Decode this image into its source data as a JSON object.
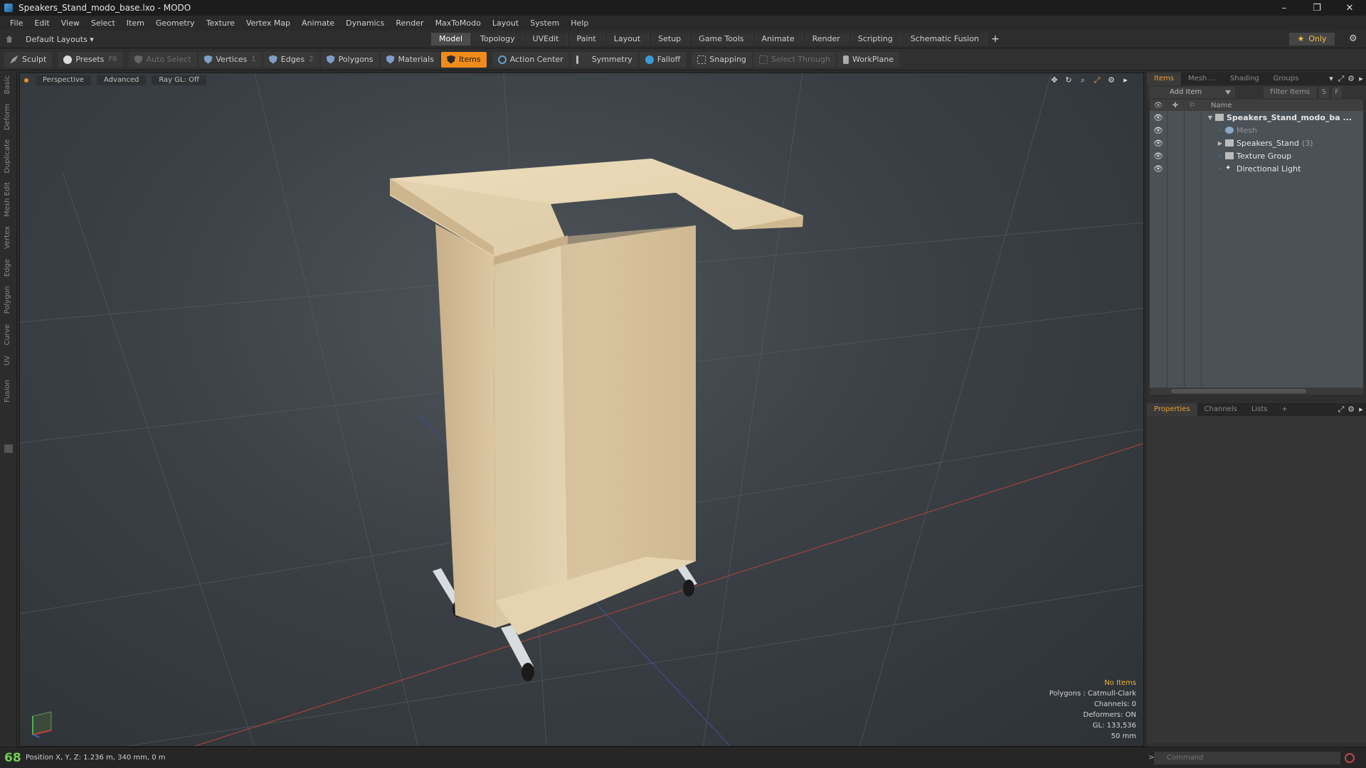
{
  "window": {
    "title": "Speakers_Stand_modo_base.lxo - MODO",
    "controls": [
      "–",
      "❐",
      "✕"
    ]
  },
  "menu": [
    "File",
    "Edit",
    "View",
    "Select",
    "Item",
    "Geometry",
    "Texture",
    "Vertex Map",
    "Animate",
    "Dynamics",
    "Render",
    "MaxToModo",
    "Layout",
    "System",
    "Help"
  ],
  "layouts": {
    "label": "Default Layouts ▾"
  },
  "tabs": [
    "Model",
    "Topology",
    "UVEdit",
    "Paint",
    "Layout",
    "Setup",
    "Game Tools",
    "Animate",
    "Render",
    "Scripting",
    "Schematic Fusion",
    "+"
  ],
  "active_tab": "Model",
  "only_label": "Only",
  "toolbar": {
    "sculpt": "Sculpt",
    "presets": "Presets",
    "presets_key": "F6",
    "auto_select": "Auto Select",
    "vertices": "Vertices",
    "vertices_key": "1",
    "edges": "Edges",
    "edges_key": "2",
    "polygons": "Polygons",
    "materials": "Materials",
    "items": "Items",
    "action_center": "Action Center",
    "symmetry": "Symmetry",
    "falloff": "Falloff",
    "snapping": "Snapping",
    "select_through": "Select Through",
    "workplane": "WorkPlane"
  },
  "left_tabs": [
    "Basic",
    "Deform",
    "Duplicate",
    "Mesh Edit",
    "Vertex",
    "Edge",
    "Polygon",
    "Curve",
    "UV",
    "Fusion"
  ],
  "viewport": {
    "view": "Perspective",
    "shading": "Advanced",
    "raygl": "Ray GL: Off",
    "hud": {
      "selection": "No Items",
      "polygons": "Polygons : Catmull-Clark",
      "channels": "Channels: 0",
      "deformers": "Deformers: ON",
      "gl": "GL: 133,536",
      "scale": "50 mm"
    }
  },
  "items_panel": {
    "tabs": [
      "Items",
      "Mesh ...",
      "Shading",
      "Groups"
    ],
    "add_item": "Add Item",
    "filter": "Filter Items",
    "s": "S",
    "f": "F",
    "column_name": "Name",
    "tree": [
      {
        "label": "Speakers_Stand_modo_ba ...",
        "level": 0,
        "expanded": true,
        "bold": true,
        "icon": "scene-icon"
      },
      {
        "label": "Mesh",
        "level": 1,
        "dim": true,
        "icon": "mesh-icon"
      },
      {
        "label": "Speakers_Stand",
        "count": "(3)",
        "level": 1,
        "collapsed": true,
        "icon": "group-icon"
      },
      {
        "label": "Texture Group",
        "level": 1,
        "icon": "group-icon"
      },
      {
        "label": "Directional Light",
        "level": 1,
        "icon": "light-icon"
      }
    ]
  },
  "properties_panel": {
    "tabs": [
      "Properties",
      "Channels",
      "Lists",
      "+"
    ]
  },
  "status": {
    "fps": "68",
    "position": "Position X, Y, Z:  1.236 m, 340 mm, 0 m",
    "command_placeholder": "Command"
  },
  "colors": {
    "accent": "#f08c1a",
    "fps": "#6fd14a",
    "hud_warn": "#f2b633"
  }
}
